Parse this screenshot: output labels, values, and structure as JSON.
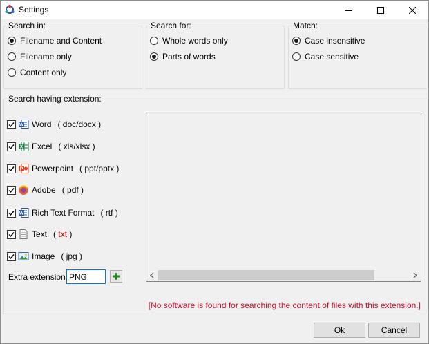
{
  "window": {
    "title": "Settings"
  },
  "search_in": {
    "label": "Search in:",
    "options": [
      {
        "label": "Filename and Content",
        "selected": true
      },
      {
        "label": "Filename only",
        "selected": false
      },
      {
        "label": "Content only",
        "selected": false
      }
    ]
  },
  "search_for": {
    "label": "Search for:",
    "options": [
      {
        "label": "Whole words only",
        "selected": false
      },
      {
        "label": "Parts of words",
        "selected": true
      }
    ]
  },
  "match": {
    "label": "Match:",
    "options": [
      {
        "label": "Case insensitive",
        "selected": true
      },
      {
        "label": "Case sensitive",
        "selected": false
      }
    ]
  },
  "extensions": {
    "label": "Search having extension:",
    "items": [
      {
        "name": "Word",
        "ext": "( doc/docx )",
        "checked": true,
        "icon": "word-icon"
      },
      {
        "name": "Excel",
        "ext": "( xls/xlsx )",
        "checked": true,
        "icon": "excel-icon"
      },
      {
        "name": "Powerpoint",
        "ext": "( ppt/pptx )",
        "checked": true,
        "icon": "powerpoint-icon"
      },
      {
        "name": "Adobe",
        "ext": "( pdf )",
        "checked": true,
        "icon": "adobe-icon"
      },
      {
        "name": "Rich Text Format",
        "ext": "( rtf )",
        "checked": true,
        "icon": "rtf-icon"
      },
      {
        "name": "Text",
        "ext_open": "(",
        "ext_red": "txt",
        "ext_close": ")",
        "checked": true,
        "icon": "text-file-icon"
      },
      {
        "name": "Image",
        "ext": "( jpg )",
        "checked": true,
        "icon": "image-icon"
      }
    ],
    "extra_label": "Extra extension:",
    "extra_value": "PNG",
    "warning": "[No software is found for searching the content of files with this extension.]"
  },
  "buttons": {
    "ok": "Ok",
    "cancel": "Cancel"
  },
  "colors": {
    "accent": "#0078d7",
    "warning": "#c8102e",
    "txt_ext": "#c00000"
  }
}
